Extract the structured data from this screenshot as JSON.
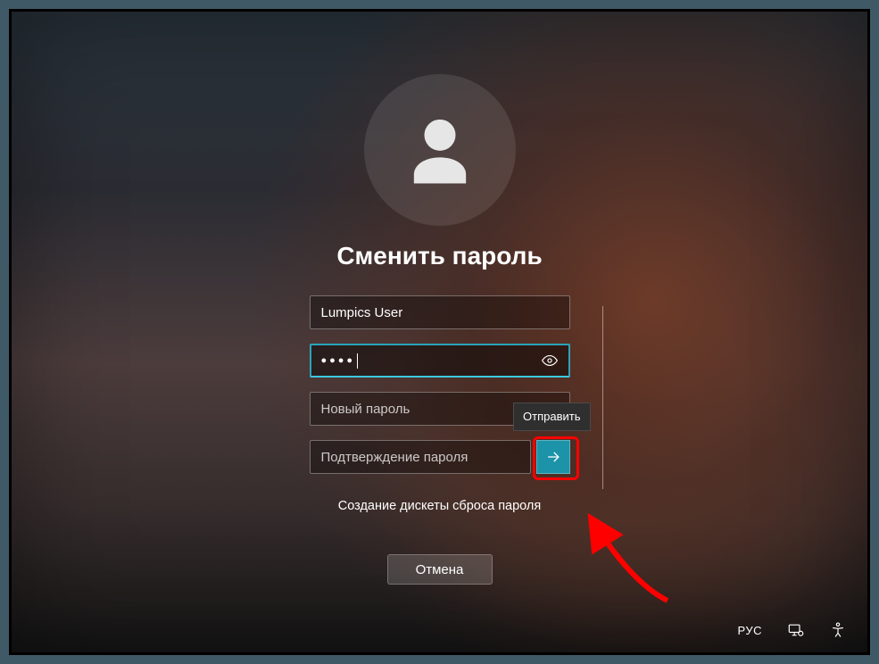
{
  "title": "Сменить пароль",
  "fields": {
    "username": {
      "value": "Lumpics User"
    },
    "current_password": {
      "value": "●●●●"
    },
    "new_password": {
      "placeholder": "Новый пароль"
    },
    "confirm_password": {
      "placeholder": "Подтверждение пароля"
    }
  },
  "tooltip": {
    "submit": "Отправить"
  },
  "link": {
    "reset_disk": "Создание дискеты сброса пароля"
  },
  "buttons": {
    "cancel": "Отмена"
  },
  "bottom": {
    "language": "РУС"
  }
}
